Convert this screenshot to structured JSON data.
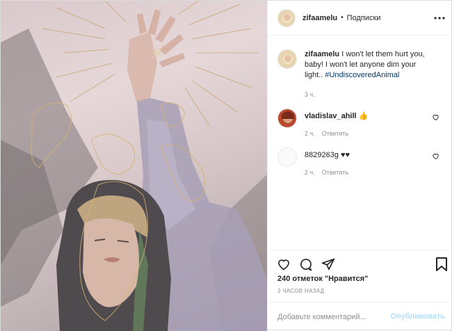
{
  "post": {
    "username": "zifaamelu",
    "separator": "•",
    "follow_status": "Подписки"
  },
  "caption": {
    "username": "zifaamelu",
    "text": "I won't let them hurt you, baby! I won't let anyone dim your light..",
    "hashtag": "#UndiscoveredAnimal",
    "time": "3 ч."
  },
  "comments": [
    {
      "username": "vladislav_ahill",
      "text": "👍",
      "time": "2 ч.",
      "reply": "Ответить"
    },
    {
      "username": "8829263g",
      "text": "♥♥",
      "time": "2 ч.",
      "reply": "Ответить"
    }
  ],
  "likes": "240 отметок \"Нравится\"",
  "posted_ago": "3 ЧАСОВ НАЗАД",
  "add_comment": {
    "placeholder": "Добавьте комментарий...",
    "publish": "Опубликовать"
  },
  "icons": {
    "more": "more-options-icon",
    "like": "heart-icon",
    "comment": "comment-icon",
    "share": "share-icon",
    "save": "bookmark-icon"
  },
  "colors": {
    "hashtag": "#00376b",
    "publish": "#b2dffc",
    "muted": "#8e8e8e"
  }
}
